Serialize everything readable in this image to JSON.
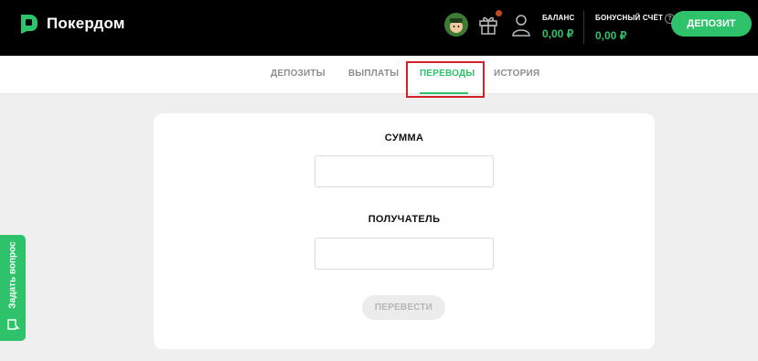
{
  "header": {
    "brand": "Покердом",
    "balance": {
      "label": "БАЛАНС",
      "value": "0,00 ₽"
    },
    "bonus": {
      "label": "БОНУСНЫЙ СЧЁТ",
      "help": "?",
      "value": "0,00 ₽"
    },
    "deposit_label": "ДЕПОЗИТ"
  },
  "tabs": [
    {
      "label": "ДЕПОЗИТЫ",
      "active": false
    },
    {
      "label": "ВЫПЛАТЫ",
      "active": false
    },
    {
      "label": "ПЕРЕВОДЫ",
      "active": true
    },
    {
      "label": "ИСТОРИЯ",
      "active": false
    }
  ],
  "form": {
    "amount_label": "СУММА",
    "amount_value": "",
    "recipient_label": "ПОЛУЧАТЕЛЬ",
    "recipient_value": "",
    "submit_label": "ПЕРЕВЕСТИ"
  },
  "feedback": {
    "label": "Задать вопрос"
  },
  "colors": {
    "accent": "#2ec36a",
    "highlight": "#d3212a",
    "header_bg": "#000000"
  },
  "icons": [
    "logo-icon",
    "avatar",
    "gift-icon",
    "user-icon",
    "chat-icon"
  ]
}
